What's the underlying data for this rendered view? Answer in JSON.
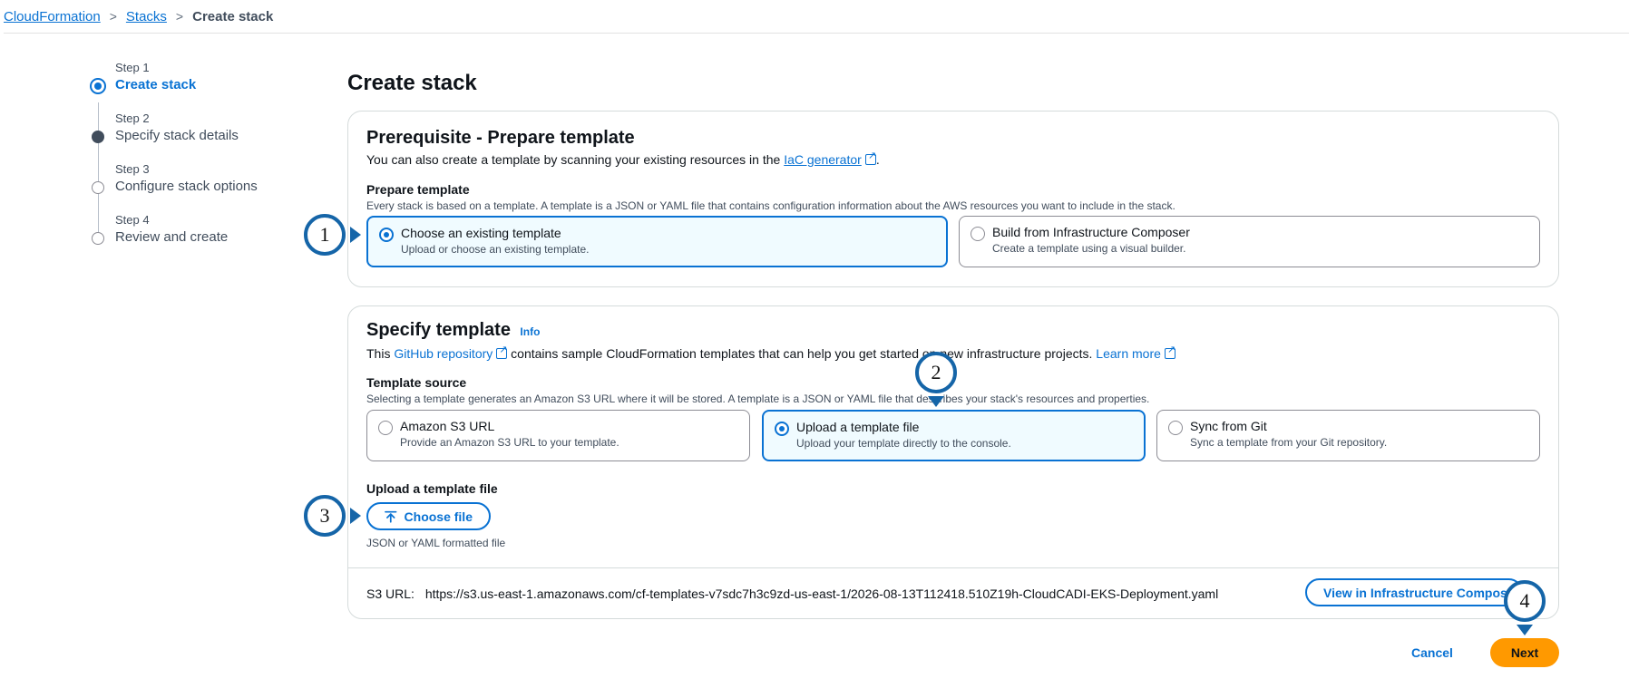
{
  "breadcrumb": {
    "root": "CloudFormation",
    "parent": "Stacks",
    "current": "Create stack",
    "sep": ">"
  },
  "steps": [
    {
      "label": "Step 1",
      "title": "Create stack"
    },
    {
      "label": "Step 2",
      "title": "Specify stack details"
    },
    {
      "label": "Step 3",
      "title": "Configure stack options"
    },
    {
      "label": "Step 4",
      "title": "Review and create"
    }
  ],
  "page_title": "Create stack",
  "prerequisite": {
    "heading": "Prerequisite - Prepare template",
    "desc_prefix": "You can also create a template by scanning your existing resources in the",
    "desc_link": "IaC generator",
    "desc_suffix": ".",
    "field_label": "Prepare template",
    "field_desc": "Every stack is based on a template. A template is a JSON or YAML file that contains configuration information about the AWS resources you want to include in the stack.",
    "options": [
      {
        "title": "Choose an existing template",
        "desc": "Upload or choose an existing template."
      },
      {
        "title": "Build from Infrastructure Composer",
        "desc": "Create a template using a visual builder."
      }
    ]
  },
  "specify": {
    "heading": "Specify template",
    "info": "Info",
    "desc_prefix": "This",
    "desc_link": "GitHub repository",
    "desc_middle": "contains sample CloudFormation templates that can help you get started on new infrastructure projects.",
    "learn_more": "Learn more",
    "source_label": "Template source",
    "source_desc": "Selecting a template generates an Amazon S3 URL where it will be stored. A template is a JSON or YAML file that describes your stack's resources and properties.",
    "options": [
      {
        "title": "Amazon S3 URL",
        "desc": "Provide an Amazon S3 URL to your template."
      },
      {
        "title": "Upload a template file",
        "desc": "Upload your template directly to the console."
      },
      {
        "title": "Sync from Git",
        "desc": "Sync a template from your Git repository."
      }
    ],
    "upload_label": "Upload a template file",
    "choose_file": "Choose file",
    "upload_hint": "JSON or YAML formatted file",
    "s3_label": "S3 URL:",
    "s3_url": "https://s3.us-east-1.amazonaws.com/cf-templates-v7sdc7h3c9zd-us-east-1/2026-08-13T112418.510Z19h-CloudCADI-EKS-Deployment.yaml",
    "view_composer": "View in Infrastructure Composer"
  },
  "footer": {
    "cancel": "Cancel",
    "next": "Next"
  },
  "callouts": [
    "1",
    "2",
    "3",
    "4"
  ]
}
